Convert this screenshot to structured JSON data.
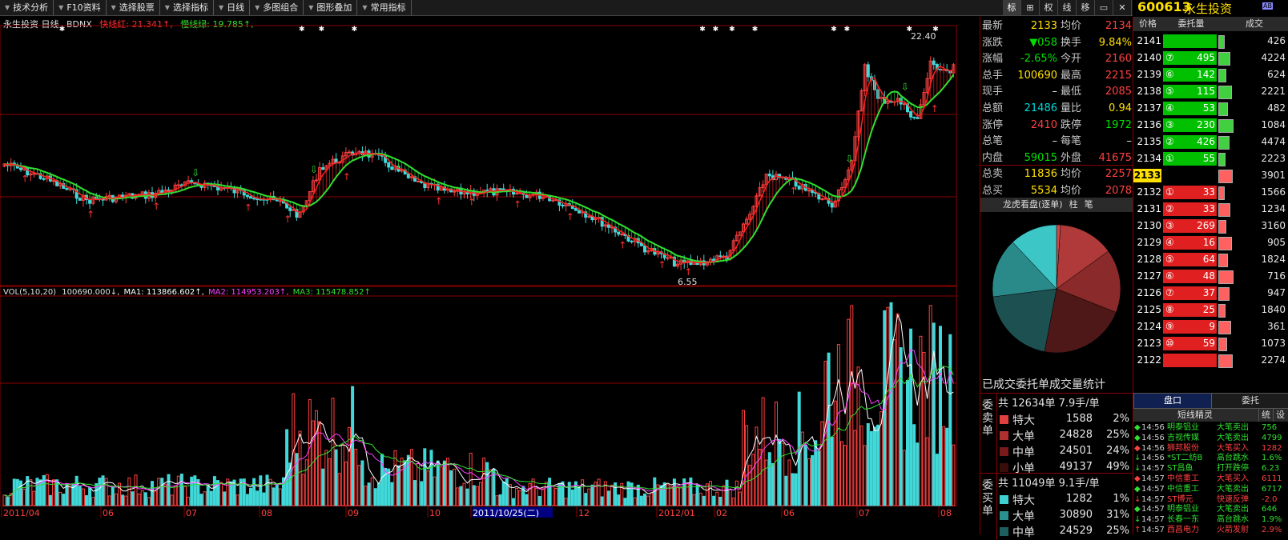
{
  "toolbar": {
    "items": [
      "技术分析",
      "F10资料",
      "选择股票",
      "选择指标",
      "日线",
      "多图组合",
      "图形叠加",
      "常用指标"
    ]
  },
  "iconstrip": {
    "items": [
      "标",
      "⊞",
      "权",
      "线",
      "移",
      "▭",
      "✕"
    ]
  },
  "stock": {
    "code": "600613",
    "name": "永生投资",
    "badge": "AB"
  },
  "chart": {
    "title": "永生投资 日线",
    "indicator_name": "BDNX",
    "fast_label": "快线红: 21.341↑,",
    "slow_label": "慢线绿: 19.785↑,",
    "high_label": "22.40",
    "low_label": "6.55",
    "vol_legend": {
      "label": "VOL(5,10,20)",
      "vol": "100690.000↓,",
      "ma1": "MA1: 113866.602↑,",
      "ma2": "MA2: 114953.203↑,",
      "ma3": "MA3: 115478.852↑"
    },
    "x_labels": [
      "2011/04",
      "06",
      "07",
      "08",
      "09",
      "10",
      "2011/10/25(二)",
      "12",
      "2012/01",
      "02",
      "06",
      "07",
      "08"
    ],
    "colors": {
      "up": "#ff4040",
      "down": "#40d8d8",
      "fast": "#ff2020",
      "slow": "#30e030",
      "grid": "#8b0000"
    }
  },
  "quote": {
    "rows": [
      {
        "l1": "最新",
        "v1": "2133",
        "c1": "yel",
        "l2": "均价",
        "v2": "2134",
        "c2": "red"
      },
      {
        "l1": "涨跌",
        "v1": "▼058",
        "c1": "green",
        "l2": "换手",
        "v2": "9.84%",
        "c2": "yel"
      },
      {
        "l1": "涨幅",
        "v1": "-2.65%",
        "c1": "green",
        "l2": "今开",
        "v2": "2160",
        "c2": "red"
      },
      {
        "l1": "总手",
        "v1": "100690",
        "c1": "yel",
        "l2": "最高",
        "v2": "2215",
        "c2": "red"
      },
      {
        "l1": "现手",
        "v1": "–",
        "c1": "wht",
        "l2": "最低",
        "v2": "2085",
        "c2": "red"
      },
      {
        "l1": "总额",
        "v1": "21486",
        "c1": "cyan",
        "l2": "量比",
        "v2": "0.94",
        "c2": "yel"
      },
      {
        "l1": "涨停",
        "v1": "2410",
        "c1": "red",
        "l2": "跌停",
        "v2": "1972",
        "c2": "green"
      },
      {
        "l1": "总笔",
        "v1": "–",
        "c1": "wht",
        "l2": "每笔",
        "v2": "–",
        "c2": "wht"
      },
      {
        "l1": "内盘",
        "v1": "59015",
        "c1": "green",
        "l2": "外盘",
        "v2": "41675",
        "c2": "red"
      },
      {
        "l1": "总卖",
        "v1": "11836",
        "c1": "yel",
        "l2": "均价",
        "v2": "2257",
        "c2": "red"
      },
      {
        "l1": "总买",
        "v1": "5534",
        "c1": "yel",
        "l2": "均价",
        "v2": "2078",
        "c2": "red"
      }
    ],
    "longhu_title": "龙虎看盘(逐单)",
    "longhu_tabs": [
      "柱",
      "笔"
    ],
    "stats_title": "已成交委托单成交量统计",
    "sell": {
      "label": "委卖单",
      "summary": "共 12634单 7.9手/单",
      "rows": [
        {
          "name": "特大",
          "val": "1588",
          "pct": "2%",
          "color": "#e04040"
        },
        {
          "name": "大单",
          "val": "24828",
          "pct": "25%",
          "color": "#b03030"
        },
        {
          "name": "中单",
          "val": "24501",
          "pct": "24%",
          "color": "#7a1a1a"
        },
        {
          "name": "小单",
          "val": "49137",
          "pct": "49%",
          "color": "#3a0d0d"
        }
      ]
    },
    "buy": {
      "label": "委买单",
      "summary": "共 11049单 9.1手/单",
      "rows": [
        {
          "name": "特大",
          "val": "1282",
          "pct": "1%",
          "color": "#40d0d0"
        },
        {
          "name": "大单",
          "val": "30890",
          "pct": "31%",
          "color": "#2a9090"
        },
        {
          "name": "中单",
          "val": "24529",
          "pct": "25%",
          "color": "#1d5f5f"
        }
      ]
    }
  },
  "book": {
    "headers": [
      "价格",
      "委托量",
      "成交"
    ],
    "sell_rows": [
      {
        "price": "2141",
        "idx": "",
        "qty": "",
        "deal": "426"
      },
      {
        "price": "2140",
        "idx": "⑦",
        "qty": "495",
        "deal": "4224"
      },
      {
        "price": "2139",
        "idx": "⑥",
        "qty": "142",
        "deal": "624"
      },
      {
        "price": "2138",
        "idx": "⑤",
        "qty": "115",
        "deal": "2221"
      },
      {
        "price": "2137",
        "idx": "④",
        "qty": "53",
        "deal": "482"
      },
      {
        "price": "2136",
        "idx": "③",
        "qty": "230",
        "deal": "1084"
      },
      {
        "price": "2135",
        "idx": "②",
        "qty": "426",
        "deal": "4474"
      },
      {
        "price": "2134",
        "idx": "①",
        "qty": "55",
        "deal": "2223"
      }
    ],
    "current": {
      "price": "2133",
      "deal": "3901"
    },
    "buy_rows": [
      {
        "price": "2132",
        "idx": "①",
        "qty": "33",
        "deal": "1566"
      },
      {
        "price": "2131",
        "idx": "②",
        "qty": "33",
        "deal": "1234"
      },
      {
        "price": "2130",
        "idx": "③",
        "qty": "269",
        "deal": "3160"
      },
      {
        "price": "2129",
        "idx": "④",
        "qty": "16",
        "deal": "905"
      },
      {
        "price": "2128",
        "idx": "⑤",
        "qty": "64",
        "deal": "1824"
      },
      {
        "price": "2127",
        "idx": "⑥",
        "qty": "48",
        "deal": "716"
      },
      {
        "price": "2126",
        "idx": "⑦",
        "qty": "37",
        "deal": "947"
      },
      {
        "price": "2125",
        "idx": "⑧",
        "qty": "25",
        "deal": "1840"
      },
      {
        "price": "2124",
        "idx": "⑨",
        "qty": "9",
        "deal": "361"
      },
      {
        "price": "2123",
        "idx": "⑩",
        "qty": "59",
        "deal": "1073"
      },
      {
        "price": "2122",
        "idx": "",
        "qty": "",
        "deal": "2274"
      }
    ],
    "tabs": [
      "盘口",
      "委托"
    ],
    "sprite": {
      "title": "短线精灵",
      "buttons": [
        "统",
        "设"
      ]
    },
    "events": [
      {
        "mark": "◆",
        "time": "14:56",
        "name": "明泰铝业",
        "act": "大笔卖出",
        "val": "756",
        "c": "green"
      },
      {
        "mark": "◆",
        "time": "14:56",
        "name": "吉视传媒",
        "act": "大笔卖出",
        "val": "4799",
        "c": "green"
      },
      {
        "mark": "◆",
        "time": "14:56",
        "name": "狮邦股份",
        "act": "大笔买入",
        "val": "1282",
        "c": "red"
      },
      {
        "mark": "↓",
        "time": "14:56",
        "name": "*ST二纺B",
        "act": "高台跳水",
        "val": "1.6%",
        "c": "green"
      },
      {
        "mark": "↓",
        "time": "14:57",
        "name": "ST昌鱼",
        "act": "打开跌停",
        "val": "6.23",
        "c": "green"
      },
      {
        "mark": "◆",
        "time": "14:57",
        "name": "中信重工",
        "act": "大笔买入",
        "val": "6111",
        "c": "red"
      },
      {
        "mark": "◆",
        "time": "14:57",
        "name": "中信重工",
        "act": "大笔卖出",
        "val": "6717",
        "c": "green"
      },
      {
        "mark": "↓",
        "time": "14:57",
        "name": "ST博元",
        "act": "快速反弹",
        "val": "-2.0",
        "c": "red"
      },
      {
        "mark": "◆",
        "time": "14:57",
        "name": "明泰铝业",
        "act": "大笔卖出",
        "val": "646",
        "c": "green"
      },
      {
        "mark": "↓",
        "time": "14:57",
        "name": "长春一东",
        "act": "高台跳水",
        "val": "1.9%",
        "c": "green"
      },
      {
        "mark": "↑",
        "time": "14:57",
        "name": "西昌电力",
        "act": "火箭发射",
        "val": "2.9%",
        "c": "red"
      }
    ]
  }
}
